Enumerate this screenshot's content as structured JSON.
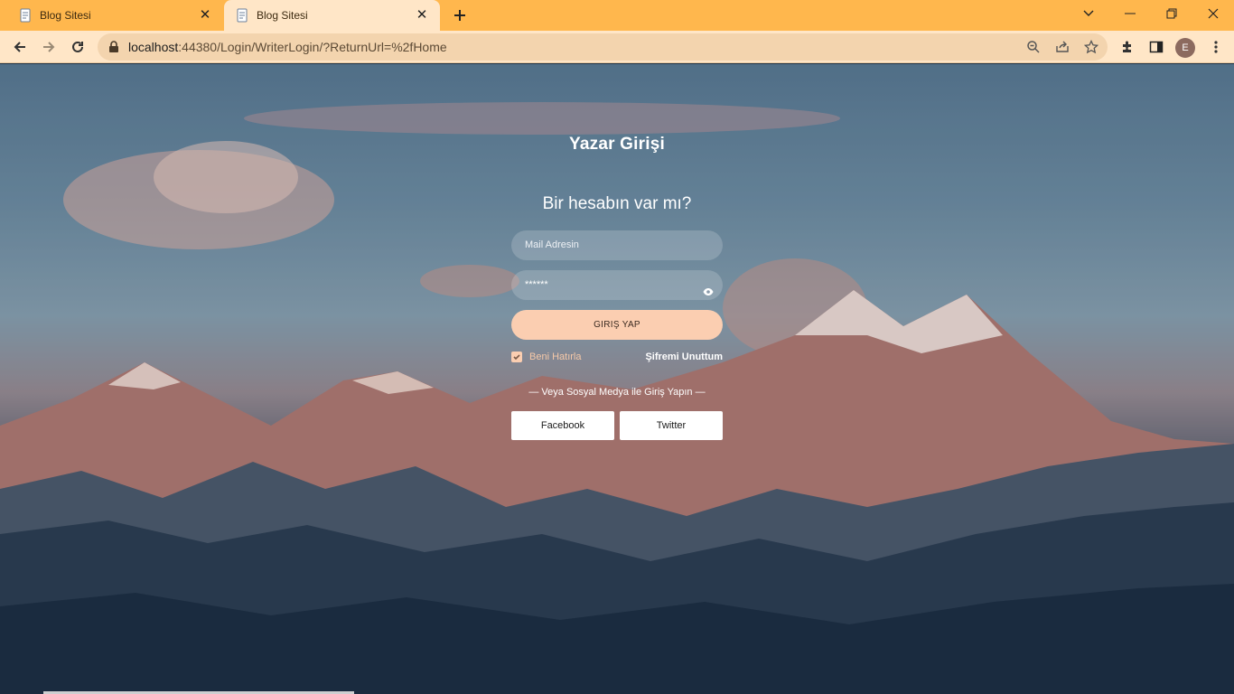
{
  "browser": {
    "tabs": [
      {
        "title": "Blog Sitesi",
        "active": false
      },
      {
        "title": "Blog Sitesi",
        "active": true
      }
    ],
    "url_host": "localhost",
    "url_rest": ":44380/Login/WriterLogin/?ReturnUrl=%2fHome",
    "profile_initial": "E"
  },
  "login": {
    "title": "Yazar Girişi",
    "subtitle": "Bir hesabın var mı?",
    "email_placeholder": "Mail Adresin",
    "password_value": "******",
    "submit_label": "GIRIŞ YAP",
    "remember_label": "Beni Hatırla",
    "remember_checked": true,
    "forgot_label": "Şifremi Unuttum",
    "social_label": "— Veya Sosyal Medya ile Giriş Yapın —",
    "facebook_label": "Facebook",
    "twitter_label": "Twitter"
  },
  "colors": {
    "tabbar": "#ffb74d",
    "toolbar": "#ffe6c7",
    "login_button": "#fbceb1",
    "remember_text": "#f6c9a8"
  }
}
